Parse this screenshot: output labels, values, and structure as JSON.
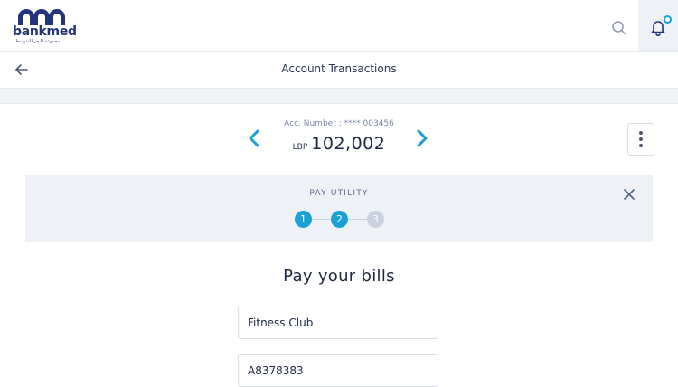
{
  "header": {
    "brand_name": "bankmed",
    "brand_tagline": "مجموعة البحر المتوسط",
    "icons": {
      "search": "search-icon",
      "notifications": "bell-icon"
    },
    "notification_dot_color": "#17a1d6"
  },
  "subheader": {
    "title": "Account Transactions",
    "back_icon": "arrow-left-icon"
  },
  "account": {
    "label": "Acc. Number : **** 003456",
    "currency": "LBP",
    "balance": "102,002",
    "prev_icon": "chevron-left-icon",
    "next_icon": "chevron-right-icon",
    "more_icon": "vertical-dots-icon"
  },
  "utility": {
    "title": "PAY UTILITY",
    "close_icon": "close-icon",
    "steps": [
      {
        "label": "1",
        "state": "complete"
      },
      {
        "label": "2",
        "state": "active"
      },
      {
        "label": "3",
        "state": "pending"
      }
    ],
    "accent_color": "#17a1d6"
  },
  "form": {
    "title": "Pay your bills",
    "biller_value": "Fitness Club",
    "reference_value": "A8378383"
  }
}
